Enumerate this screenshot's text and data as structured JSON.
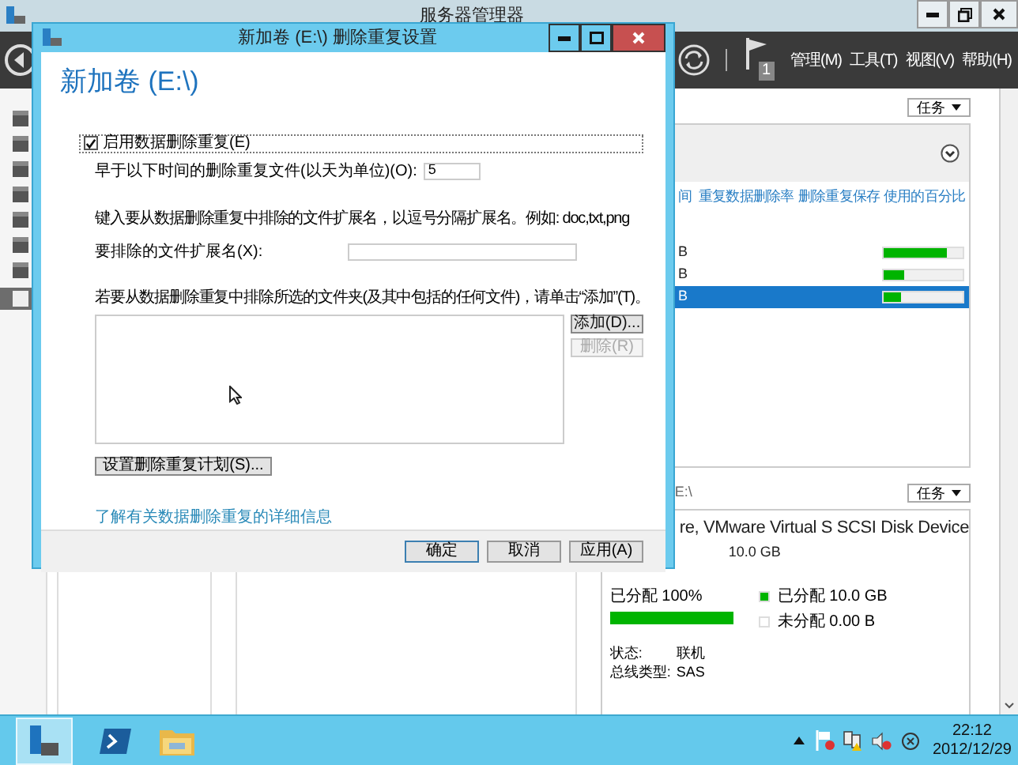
{
  "app": {
    "title": "服务器管理器",
    "flag_count": "1",
    "menu": [
      "管理(M)",
      "工具(T)",
      "视图(V)",
      "帮助(H)"
    ]
  },
  "volumes_panel": {
    "tasks": "任务",
    "columns": [
      "间",
      "重复数据删除率",
      "删除重复保存",
      "使用的百分比"
    ],
    "rows": [
      {
        "column_1": "B",
        "level": 0.8,
        "selected": false
      },
      {
        "column_1": "B",
        "level": 0.25,
        "selected": false
      },
      {
        "column_1": "B",
        "level": 0.22,
        "selected": true
      }
    ]
  },
  "disk_panel": {
    "path": "E:\\",
    "tasks": "任务",
    "title": "re, VMware Virtual S SCSI Disk Device",
    "size": "10.0 GB",
    "allocated": "已分配 100%",
    "level": 1,
    "legend": [
      {
        "label": "已分配 10.0 GB",
        "color": "#00b400"
      },
      {
        "label": "未分配 0.00 B",
        "color": "#ffffff"
      }
    ],
    "properties": [
      {
        "label": "状态:",
        "value": "联机"
      },
      {
        "label": "总线类型:",
        "value": "SAS"
      }
    ]
  },
  "dialog": {
    "title": "新加卷 (E:\\) 删除重复设置",
    "heading": "新加卷 (E:\\)",
    "enable": {
      "label": "启用数据删除重复(E)",
      "checked": true
    },
    "age": {
      "label": "早于以下时间的删除重复文件(以天为单位)(O):",
      "value": "5"
    },
    "extensions_hint": "键入要从数据删除重复中排除的文件扩展名，以逗号分隔扩展名。例如: doc,txt,png",
    "extensions": {
      "label": "要排除的文件扩展名(X):"
    },
    "folders_hint": "若要从数据删除重复中排除所选的文件夹(及其中包括的任何文件)，请单击“添加”(T)。",
    "folder_buttons": [
      {
        "label": "添加(D)...",
        "disabled": false
      },
      {
        "label": "删除(R)",
        "disabled": true
      }
    ],
    "schedule_button": "设置删除重复计划(S)...",
    "link": "了解有关数据删除重复的详细信息",
    "buttons": [
      "确定",
      "取消",
      "应用(A)"
    ]
  },
  "taskbar": {
    "time": "22:12",
    "date": "2012/12/29"
  }
}
